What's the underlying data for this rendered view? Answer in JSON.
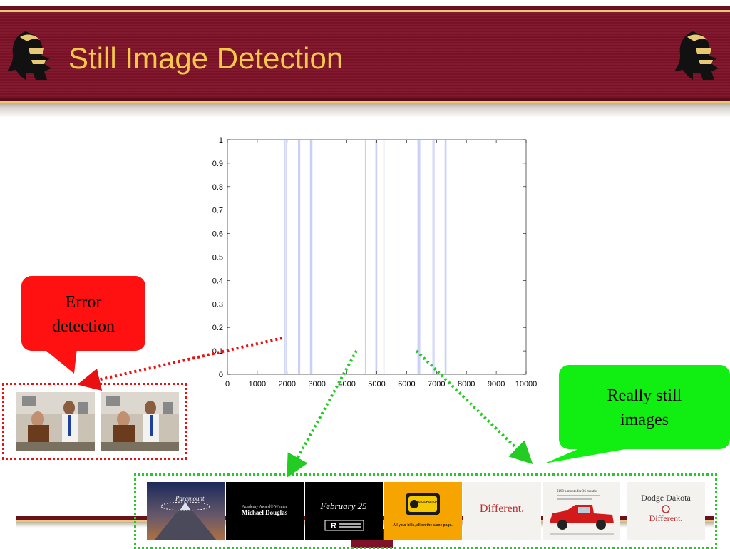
{
  "slide": {
    "title": "Still Image Detection",
    "logo_icon": "trojan-helmet-icon"
  },
  "callouts": {
    "error": {
      "line1": "Error",
      "line2": "detection",
      "color": "#ff1111"
    },
    "still": {
      "line1": "Really still",
      "line2": "images",
      "color": "#11ee11"
    }
  },
  "thumbnails_error": [
    {
      "icon": "seinfeld-scene-thumbnail"
    },
    {
      "icon": "seinfeld-scene-thumbnail"
    }
  ],
  "thumbnails_still": [
    {
      "icon": "paramount-logo-thumbnail",
      "text": ""
    },
    {
      "icon": "black-title-card-thumbnail",
      "text_line1": "Academy Award® Winner",
      "text_line2": "Michael Douglas"
    },
    {
      "icon": "black-title-card-thumbnail",
      "text_line1": "February 25",
      "text_line2": "R"
    },
    {
      "icon": "yellow-ad-thumbnail",
      "text_line1": "STATUS FACTORY",
      "text_line2": "All your bills, all on the same page."
    },
    {
      "icon": "white-ad-thumbnail",
      "text_line1": "Different."
    },
    {
      "icon": "red-truck-ad-thumbnail",
      "text_line1": "$199 a month for 36 months"
    },
    {
      "icon": "white-ad-thumbnail",
      "text_line1": "Dodge Dakota",
      "text_line2": "Different."
    }
  ],
  "chart_data": {
    "type": "bar",
    "title": "",
    "xlabel": "",
    "ylabel": "",
    "xlim": [
      0,
      10000
    ],
    "ylim": [
      0,
      1
    ],
    "x_ticks": [
      0,
      1000,
      2000,
      3000,
      4000,
      5000,
      6000,
      7000,
      8000,
      9000,
      10000
    ],
    "x_tick_labels": [
      "0",
      "1000",
      "2000",
      "3000",
      "4000",
      "5000",
      "6000",
      "7000",
      "8000",
      "9000",
      "10000"
    ],
    "y_ticks": [
      0,
      0.1,
      0.2,
      0.3,
      0.4,
      0.5,
      0.6,
      0.7,
      0.8,
      0.9,
      1
    ],
    "y_tick_labels": [
      "0",
      "0.1",
      "0.2",
      "0.3",
      "0.4",
      "0.5",
      "0.6",
      "0.7",
      "0.8",
      "0.9",
      "1"
    ],
    "series": [
      {
        "color": "#c8d0f8",
        "spikes": [
          {
            "x": 1930,
            "value": 1
          },
          {
            "x": 1980,
            "value": 1
          },
          {
            "x": 2380,
            "value": 1
          },
          {
            "x": 2420,
            "value": 1
          },
          {
            "x": 2780,
            "value": 1
          },
          {
            "x": 2800,
            "value": 1
          },
          {
            "x": 2830,
            "value": 1
          },
          {
            "x": 4620,
            "value": 1
          },
          {
            "x": 4970,
            "value": 1
          },
          {
            "x": 5000,
            "value": 1
          },
          {
            "x": 5240,
            "value": 1
          },
          {
            "x": 6380,
            "value": 1
          },
          {
            "x": 6410,
            "value": 1
          },
          {
            "x": 6440,
            "value": 1
          },
          {
            "x": 6880,
            "value": 1
          },
          {
            "x": 6920,
            "value": 1
          },
          {
            "x": 7290,
            "value": 1
          },
          {
            "x": 7320,
            "value": 1
          }
        ]
      }
    ],
    "grid": false,
    "legend": "none"
  }
}
